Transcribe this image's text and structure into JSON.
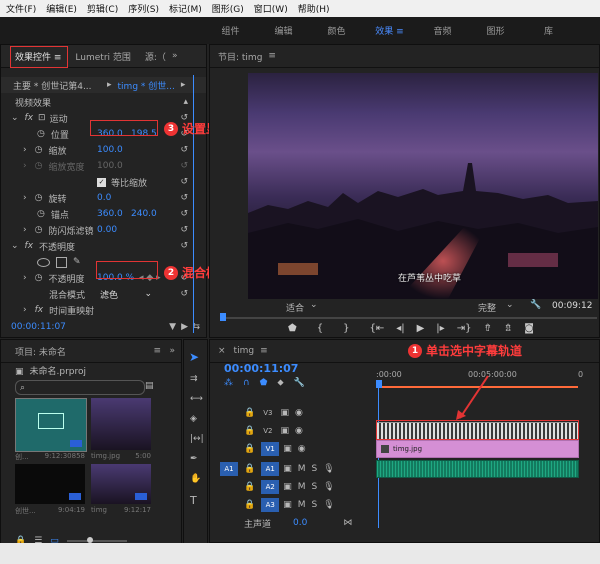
{
  "menu": [
    "文件(F)",
    "编辑(E)",
    "剪辑(C)",
    "序列(S)",
    "标记(M)",
    "图形(G)",
    "窗口(W)",
    "帮助(H)"
  ],
  "workspaces": {
    "tabs": [
      "组件",
      "编辑",
      "颜色",
      "效果",
      "音频",
      "图形",
      "库"
    ],
    "active_index": 3
  },
  "effect_controls": {
    "tab_label": "效果控件",
    "tab2_label": "Lumetri 范围",
    "tab3_label": "源:（",
    "master_label": "主要 * 创世记第4...",
    "clip_label": "timg * 创世...",
    "video_effects": "视频效果",
    "motion": "运动",
    "position_label": "位置",
    "position_x": "360.0",
    "position_y": "198.5",
    "scale_label": "缩放",
    "scale_value": "100.0",
    "scale_width_label": "缩放宽度",
    "scale_width_value": "100.0",
    "uniform_label": "等比缩放",
    "rotation_label": "旋转",
    "rotation_value": "0.0",
    "anchor_label": "锚点",
    "anchor_x": "360.0",
    "anchor_y": "240.0",
    "antiflicker_label": "防闪烁滤镜",
    "antiflicker_value": "0.00",
    "opacity_section": "不透明度",
    "opacity_label": "不透明度",
    "opacity_value": "100.0 %",
    "blend_label": "混合模式",
    "blend_value": "滤色",
    "time_remap": "时间重映射",
    "timecode": "00:00:11:07"
  },
  "callouts": {
    "c1_num": "1",
    "c1_text": "单击选中字幕轨道",
    "c2_num": "2",
    "c2_text": "混合模式：滤色",
    "c3_num": "3",
    "c3_text": "设置显示位置"
  },
  "program": {
    "title": "节目: timg",
    "subtitle": "在芦苇丛中吃草",
    "fit": "适合",
    "quality": "完整",
    "timecode_right": "00:09:12",
    "accent": "#3c8cff"
  },
  "project": {
    "title": "项目: 未命名",
    "file": "未命名.prproj",
    "items": [
      {
        "name": "创...",
        "duration": "9:12:30858"
      },
      {
        "name": "timg.jpg",
        "duration": "5:00"
      },
      {
        "name": "创世...",
        "duration": "9:04:19"
      },
      {
        "name": "timg",
        "duration": "9:12:17"
      }
    ]
  },
  "timeline": {
    "tab_label": "timg",
    "timecode": "00:00:11:07",
    "ruler_start": ":00:00",
    "ruler_mid": "00:05:00:00",
    "ruler_end": "0",
    "tracks_video": [
      "V3",
      "V2",
      "V1"
    ],
    "tracks_audio": [
      "A1",
      "A2",
      "A3"
    ],
    "src_v": "V1",
    "src_a": "A1",
    "clip_name": "timg.jpg",
    "master_label": "主声道",
    "master_value": "0.0"
  }
}
